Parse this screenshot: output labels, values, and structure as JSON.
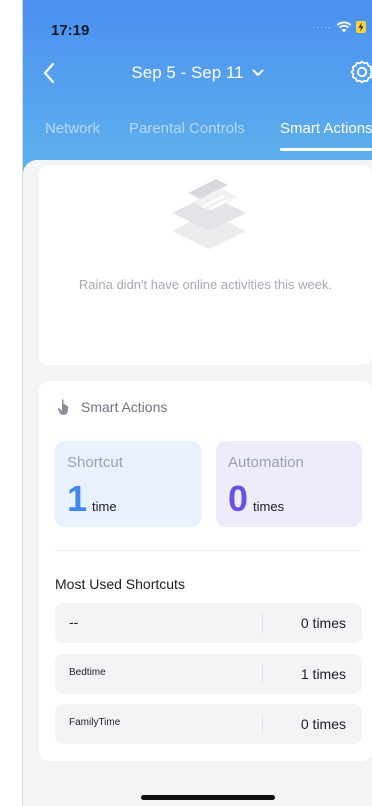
{
  "status": {
    "time": "17:19"
  },
  "nav": {
    "date_range": "Sep 5 - Sep 11"
  },
  "tabs": [
    {
      "label": "Network"
    },
    {
      "label": "Parental Controls"
    },
    {
      "label": "Smart Actions"
    }
  ],
  "empty_state": {
    "message": "Raina didn't have online activities this week."
  },
  "smart_actions": {
    "title": "Smart Actions",
    "shortcut": {
      "label": "Shortcut",
      "value": "1",
      "unit": "time"
    },
    "automation": {
      "label": "Automation",
      "value": "0",
      "unit": "times"
    },
    "most_used_title": "Most Used Shortcuts",
    "rows": [
      {
        "name": "--",
        "count": "0 times"
      },
      {
        "name": "Bedtime",
        "count": "1 times"
      },
      {
        "name": "FamilyTime",
        "count": "0 times"
      }
    ]
  },
  "colors": {
    "header_gradient_top": "#4a8ff0",
    "header_gradient_bottom": "#5fb2ec",
    "shortcut_accent": "#4187f1",
    "automation_accent": "#6c4fe0"
  }
}
